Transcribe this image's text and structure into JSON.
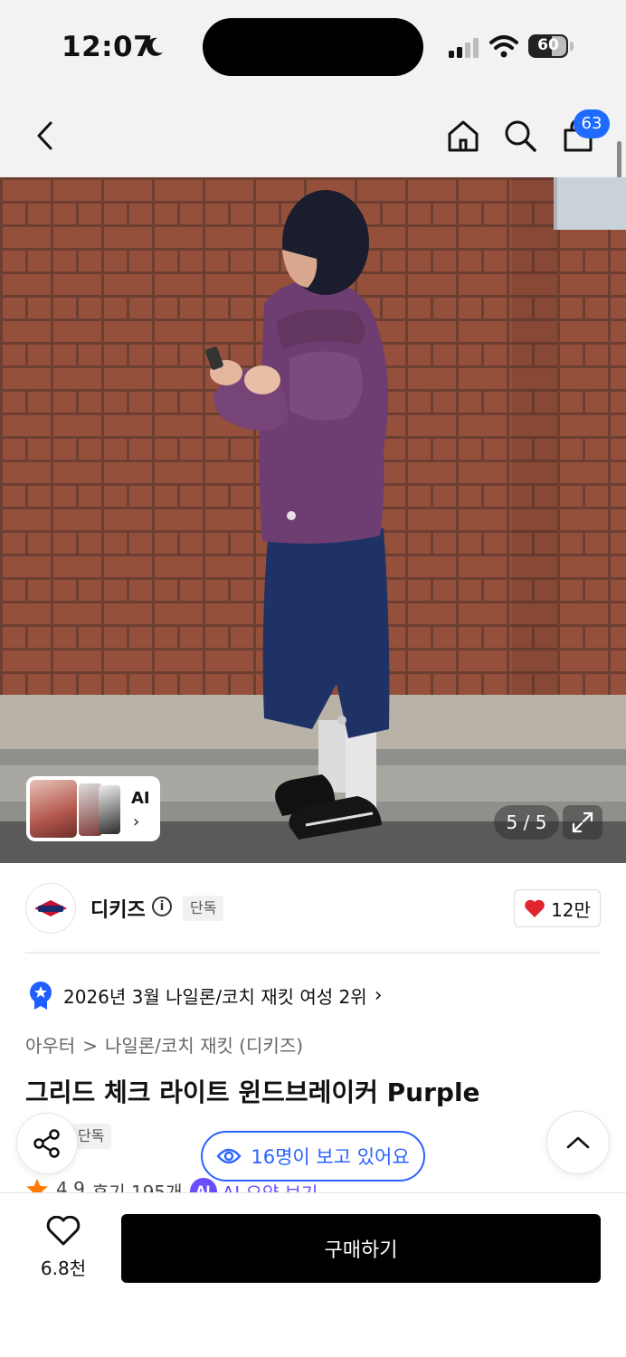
{
  "status_bar": {
    "time": "12:07",
    "battery": "60",
    "battery_level": 0.6
  },
  "header": {
    "cart_count": "63"
  },
  "gallery": {
    "thumb_label": "AI",
    "thumb_chevron": "›",
    "pager": "5 / 5"
  },
  "brand": {
    "name": "디키즈",
    "info_glyph": "i",
    "exclusive_tag": "단독",
    "likes": "12만"
  },
  "ranking": {
    "text": "2026년 3월 나일론/코치 재킷 여성 2위",
    "chevron": "›"
  },
  "breadcrumb": {
    "level1": "아우터",
    "separator": ">",
    "level2": "나일론/코치 재킷 (디키즈)"
  },
  "product": {
    "title": "그리드 체크 라이트 윈드브레이커 Purple",
    "exclusive_tag": "단독"
  },
  "floating": {
    "viewers": "16명이 보고 있어요"
  },
  "reviews": {
    "rating": "4.9",
    "count_label": "후기 195개",
    "ai_badge": "AI",
    "ai_summary": "AI 요약 보기"
  },
  "bottom": {
    "wish_count": "6.8천",
    "buy_label": "구매하기"
  },
  "colors": {
    "accent_blue": "#2a62ff",
    "badge_blue": "#1f6bff",
    "heart_red": "#e0252f",
    "star_orange": "#ff7a00",
    "ai_purple": "#6a4dff"
  },
  "icons": [
    "moon-icon",
    "signal-icon",
    "wifi-icon",
    "back-chevron-icon",
    "home-icon",
    "search-icon",
    "shopping-bag-icon",
    "expand-icon",
    "info-icon",
    "heart-icon",
    "medal-icon",
    "share-icon",
    "eye-icon",
    "chevron-up-icon",
    "star-icon",
    "heart-outline-icon"
  ]
}
